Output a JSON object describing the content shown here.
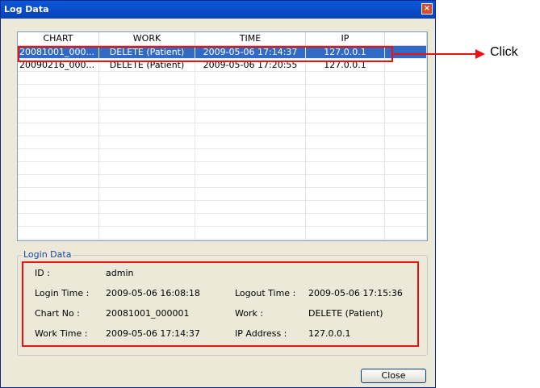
{
  "window": {
    "title": "Log Data",
    "close_glyph": "×"
  },
  "table": {
    "headers": [
      "CHART",
      "WORK",
      "TIME",
      "IP",
      ""
    ],
    "rows": [
      [
        "20081001_000...",
        "DELETE (Patient)",
        "2009-05-06 17:14:37",
        "127.0.0.1",
        ""
      ],
      [
        "20090216_000...",
        "DELETE (Patient)",
        "2009-05-06 17:20:55",
        "127.0.0.1",
        ""
      ]
    ]
  },
  "login": {
    "legend": "Login Data",
    "id_label": "ID :",
    "id_value": "admin",
    "login_time_label": "Login Time :",
    "login_time_value": "2009-05-06 16:08:18",
    "logout_time_label": "Logout Time :",
    "logout_time_value": "2009-05-06 17:15:36",
    "chart_no_label": "Chart No :",
    "chart_no_value": "20081001_000001",
    "work_label": "Work :",
    "work_value": "DELETE (Patient)",
    "work_time_label": "Work Time :",
    "work_time_value": "2009-05-06 17:14:37",
    "ip_label": "IP Address :",
    "ip_value": "127.0.0.1"
  },
  "buttons": {
    "close": "Close"
  },
  "annotation": {
    "callout": "Click"
  }
}
